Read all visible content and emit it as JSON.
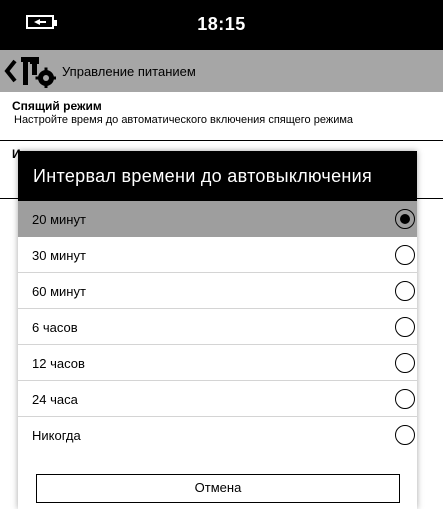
{
  "status_bar": {
    "time": "18:15",
    "battery_icon": "battery-charging-icon"
  },
  "app_bar": {
    "title": "Управление питанием",
    "back_icon": "back-chevron-icon",
    "settings_icon": "tools-gear-icon"
  },
  "settings": [
    {
      "title": "Спящий режим",
      "subtitle": "Настройте время до автоматического включения спящего режима"
    },
    {
      "title": "И"
    }
  ],
  "dialog": {
    "title": "Интервал времени до автовыключения",
    "options": [
      {
        "label": "20 минут",
        "selected": true
      },
      {
        "label": "30 минут",
        "selected": false
      },
      {
        "label": "60 минут",
        "selected": false
      },
      {
        "label": "6 часов",
        "selected": false
      },
      {
        "label": "12 часов",
        "selected": false
      },
      {
        "label": "24 часа",
        "selected": false
      },
      {
        "label": "Никогда",
        "selected": false
      }
    ],
    "cancel_label": "Отмена"
  }
}
